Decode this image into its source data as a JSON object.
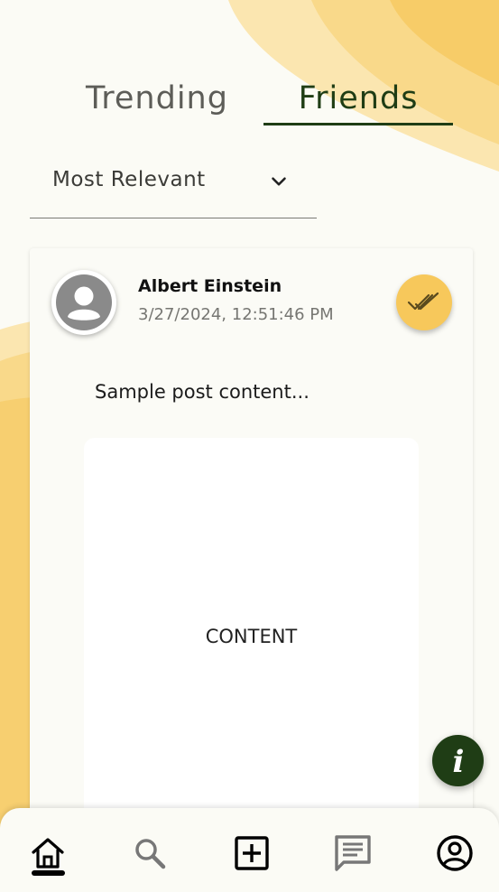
{
  "tabs": [
    {
      "label": "Trending",
      "active": false
    },
    {
      "label": "Friends",
      "active": true
    }
  ],
  "sort": {
    "selected": "Most Relevant"
  },
  "post": {
    "author": "Albert Einstein",
    "timestamp": "3/27/2024, 12:51:46 PM",
    "text": "Sample post content...",
    "media_label": "CONTENT",
    "action_icon": "double-check-icon"
  },
  "fab": {
    "icon": "info-icon"
  },
  "bottom_nav": [
    {
      "name": "home",
      "icon": "home-icon",
      "active": true
    },
    {
      "name": "search",
      "icon": "search-icon",
      "active": false
    },
    {
      "name": "create",
      "icon": "add-box-icon",
      "active": false
    },
    {
      "name": "messages",
      "icon": "chat-icon",
      "active": false
    },
    {
      "name": "profile",
      "icon": "account-circle-icon",
      "active": false
    }
  ],
  "colors": {
    "accent": "#f7c85b",
    "primary": "#1f3d15",
    "background": "#fbfbf5"
  }
}
